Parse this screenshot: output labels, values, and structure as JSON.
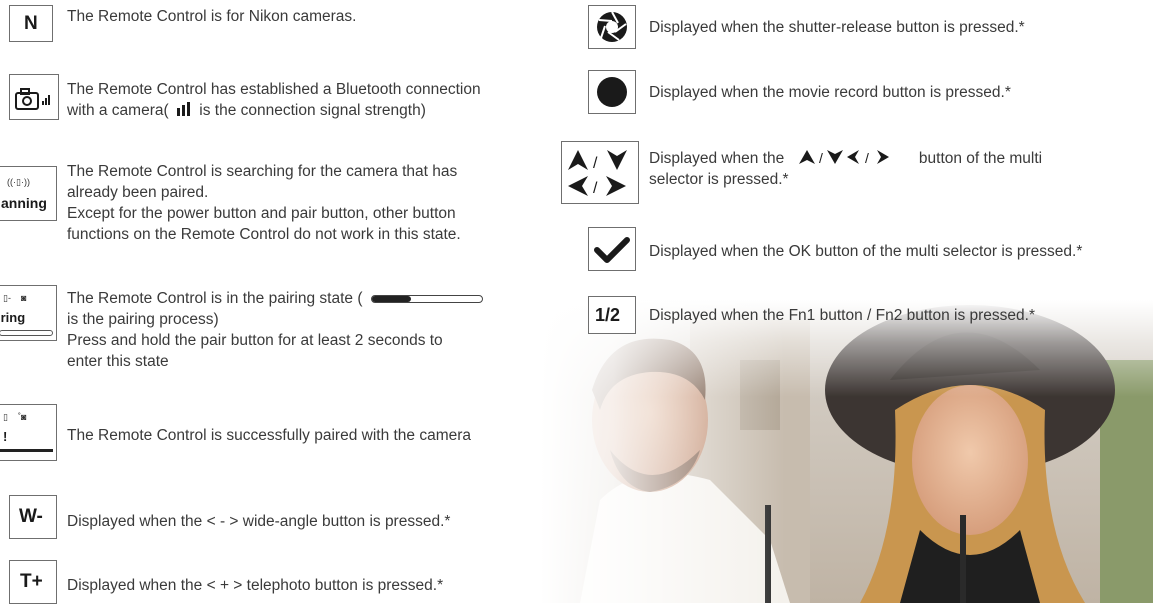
{
  "left_items": [
    {
      "icon": "N",
      "lines": [
        "The Remote Control is for Nikon cameras."
      ]
    },
    {
      "icon": "camera-signal",
      "lines": [
        "The Remote Control has established a Bluetooth connection",
        "with a camera(",
        "is the connection signal strength)"
      ]
    },
    {
      "icon": "scanning",
      "icon_text": "anning",
      "lines": [
        "The Remote Control is searching for the camera that has",
        "already been paired.",
        "Except for the power button and pair button, other button",
        "functions on the Remote Control do not work in this state."
      ]
    },
    {
      "icon": "pairing",
      "icon_text": "iring",
      "lines": [
        "The Remote Control is in the pairing state (",
        "is the pairing process)",
        "Press and hold the pair button for at least 2 seconds to",
        "enter this state"
      ]
    },
    {
      "icon": "paired",
      "icon_text": "!",
      "lines": [
        "The Remote Control is successfully paired with the camera"
      ]
    },
    {
      "icon": "W-",
      "lines": [
        "Displayed when the < - > wide-angle button is pressed.*"
      ]
    },
    {
      "icon": "T+",
      "lines": [
        "Displayed when the < + > telephoto button is pressed.*"
      ]
    }
  ],
  "right_items": [
    {
      "icon": "shutter",
      "lines": [
        "Displayed when the shutter-release button is pressed.*"
      ]
    },
    {
      "icon": "record",
      "lines": [
        "Displayed when the movie record button is pressed.*"
      ]
    },
    {
      "icon": "arrows",
      "lines": [
        "Displayed when the",
        "button of the multi",
        "selector is pressed.*"
      ]
    },
    {
      "icon": "check",
      "lines": [
        "Displayed when the OK button of the multi selector is pressed.*"
      ]
    },
    {
      "icon": "1/2",
      "lines": [
        "Displayed when the Fn1 button / Fn2 button is pressed.*"
      ]
    }
  ],
  "colors": {
    "text": "#3a3a3a",
    "border": "#6f6f6f",
    "icon": "#1a1a1a"
  }
}
